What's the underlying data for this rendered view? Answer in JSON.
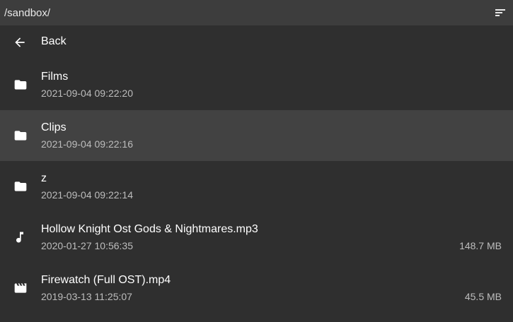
{
  "header": {
    "path": "/sandbox/",
    "sort_icon": "sort-icon"
  },
  "back": {
    "icon": "arrow-left-icon",
    "label": "Back"
  },
  "entries": [
    {
      "type": "folder",
      "icon": "folder-icon",
      "name": "Films",
      "date": "2021-09-04 09:22:20",
      "size": ""
    },
    {
      "type": "folder",
      "icon": "folder-icon",
      "name": "Clips",
      "date": "2021-09-04 09:22:16",
      "size": "",
      "selected": true
    },
    {
      "type": "folder",
      "icon": "folder-icon",
      "name": "z",
      "date": "2021-09-04 09:22:14",
      "size": ""
    },
    {
      "type": "audio",
      "icon": "music-note-icon",
      "name": "Hollow Knight Ost Gods & Nightmares.mp3",
      "date": "2020-01-27 10:56:35",
      "size": "148.7 MB"
    },
    {
      "type": "video",
      "icon": "movie-icon",
      "name": "Firewatch (Full OST).mp4",
      "date": "2019-03-13 11:25:07",
      "size": "45.5 MB"
    }
  ],
  "colors": {
    "background": "#2f2f2f",
    "header_bg": "#3d3d3d",
    "selected_bg": "#424242",
    "text_primary": "#ffffff",
    "text_secondary": "#bdbdbd"
  }
}
